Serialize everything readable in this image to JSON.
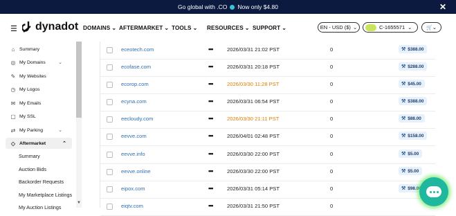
{
  "banner": {
    "text_before": "Go global with .CO",
    "text_after": "Now only $4.80",
    "close": "✕"
  },
  "header": {
    "logo_text": "dynadot",
    "menu": [
      "DOMAINS",
      "AFTERMARKET",
      "TOOLS",
      "RESOURCES",
      "SUPPORT"
    ],
    "currency": "EN - USD ($)",
    "account": "C-1655571",
    "cart_icon": "🛒"
  },
  "sidebar": {
    "items": [
      {
        "label": "Summary",
        "icon": "⌂"
      },
      {
        "label": "My Domains",
        "icon": "◎"
      },
      {
        "label": "My Websites",
        "icon": "✎"
      },
      {
        "label": "My Logos",
        "icon": "◷"
      },
      {
        "label": "My Emails",
        "icon": "✉"
      },
      {
        "label": "My SSL",
        "icon": "▢"
      },
      {
        "label": "My Parking",
        "icon": "⇄"
      },
      {
        "label": "Aftermarket",
        "icon": "◇"
      }
    ],
    "chevron_down": "⌄",
    "chevron_up": "⌃",
    "submenu": [
      "Summary",
      "Auction Bids",
      "Backorder Requests",
      "My Marketplace Listings",
      "My Auction Listings"
    ]
  },
  "table": {
    "rows": [
      {
        "domain": "eceotech.com",
        "date": "2026/03/31 21:02 PST",
        "bids": "0",
        "price": "$388.00",
        "highlight": false
      },
      {
        "domain": "ecofase.com",
        "date": "2026/03/31 20:18 PST",
        "bids": "0",
        "price": "$288.00",
        "highlight": false
      },
      {
        "domain": "ecorop.com",
        "date": "2026/03/30 11:28 PST",
        "bids": "0",
        "price": "$45.00",
        "highlight": true
      },
      {
        "domain": "ecyna.com",
        "date": "2026/03/31 06:54 PST",
        "bids": "0",
        "price": "$388.00",
        "highlight": false
      },
      {
        "domain": "eecloudy.com",
        "date": "2026/03/30 21:11 PST",
        "bids": "0",
        "price": "$88.00",
        "highlight": true
      },
      {
        "domain": "eevve.com",
        "date": "2026/04/01 02:48 PST",
        "bids": "0",
        "price": "$158.00",
        "highlight": false
      },
      {
        "domain": "eevve.info",
        "date": "2026/03/30 22:00 PST",
        "bids": "0",
        "price": "$5.00",
        "highlight": false
      },
      {
        "domain": "eevve.online",
        "date": "2026/03/30 22:00 PST",
        "bids": "0",
        "price": "$5.00",
        "highlight": false
      },
      {
        "domain": "eipox.com",
        "date": "2026/03/31 05:14 PST",
        "bids": "0",
        "price": "$98.00",
        "highlight": false
      },
      {
        "domain": "eiqtv.com",
        "date": "2026/03/31 21:50 PST",
        "bids": "0",
        "price": "",
        "highlight": false
      }
    ],
    "more_icon": "•••",
    "hammer_icon": "⚒"
  }
}
